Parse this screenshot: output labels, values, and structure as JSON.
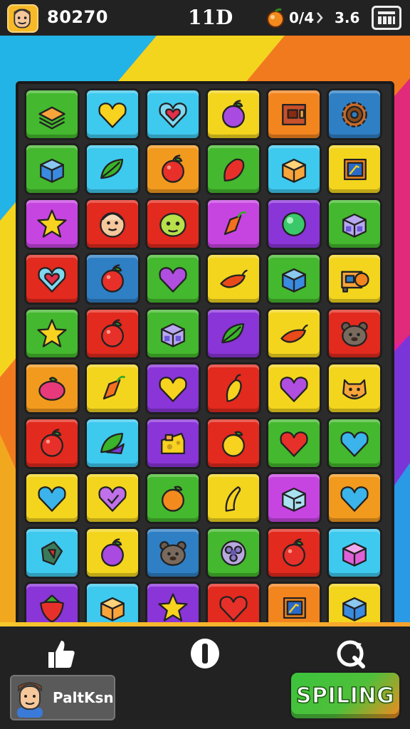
{
  "header": {
    "score": "80270",
    "level": "11D",
    "fruit_ratio": "0/4",
    "moves": "3.6",
    "fruit_icon": "orange-fruit-icon",
    "menu_icon": "grid-menu-icon"
  },
  "board": {
    "rows": [
      [
        {
          "c": "#44b82e",
          "i": "layers"
        },
        {
          "c": "#3ec9ef",
          "i": "heart-yellow"
        },
        {
          "c": "#3ec9ef",
          "i": "heart-outline"
        },
        {
          "c": "#f3d51e",
          "i": "apple-purple"
        },
        {
          "c": "#f2851e",
          "i": "box-brown"
        },
        {
          "c": "#2f7fc4",
          "i": "gear"
        }
      ],
      [
        {
          "c": "#44b82e",
          "i": "cube-blue"
        },
        {
          "c": "#3ec9ef",
          "i": "leaf-green"
        },
        {
          "c": "#f29a1e",
          "i": "apple-red"
        },
        {
          "c": "#44b82e",
          "i": "pepper-red"
        },
        {
          "c": "#3ec9ef",
          "i": "box-orange"
        },
        {
          "c": "#f3d51e",
          "i": "card-blue"
        }
      ],
      [
        {
          "c": "#c645e0",
          "i": "star-yellow"
        },
        {
          "c": "#e22a1e",
          "i": "face-round"
        },
        {
          "c": "#e22a1e",
          "i": "face-green"
        },
        {
          "c": "#c645e0",
          "i": "carrot"
        },
        {
          "c": "#8a35d8",
          "i": "ball-green"
        },
        {
          "c": "#44b82e",
          "i": "cube-lilac"
        }
      ],
      [
        {
          "c": "#e22a1e",
          "i": "heart-outline"
        },
        {
          "c": "#2f7fc4",
          "i": "apple-red"
        },
        {
          "c": "#44b82e",
          "i": "heart-purple"
        },
        {
          "c": "#f3d51e",
          "i": "chili"
        },
        {
          "c": "#44b82e",
          "i": "cube-blue"
        },
        {
          "c": "#f3d51e",
          "i": "machine"
        }
      ],
      [
        {
          "c": "#44b82e",
          "i": "star-yellow"
        },
        {
          "c": "#e22a1e",
          "i": "apple-red"
        },
        {
          "c": "#44b82e",
          "i": "cube-lilac"
        },
        {
          "c": "#8a35d8",
          "i": "leaf-green"
        },
        {
          "c": "#f3d51e",
          "i": "chili"
        },
        {
          "c": "#e22a1e",
          "i": "face-bear"
        }
      ],
      [
        {
          "c": "#f29a1e",
          "i": "plum"
        },
        {
          "c": "#f3d51e",
          "i": "carrot"
        },
        {
          "c": "#8a35d8",
          "i": "heart-yellow"
        },
        {
          "c": "#e22a1e",
          "i": "pepper-yellow"
        },
        {
          "c": "#f3d51e",
          "i": "heart-purple"
        },
        {
          "c": "#f3d51e",
          "i": "face-tiger"
        }
      ],
      [
        {
          "c": "#e22a1e",
          "i": "apple-red"
        },
        {
          "c": "#3ec9ef",
          "i": "leaf-purple"
        },
        {
          "c": "#8a35d8",
          "i": "cheese"
        },
        {
          "c": "#e22a1e",
          "i": "apple-yellow"
        },
        {
          "c": "#44b82e",
          "i": "heart-red"
        },
        {
          "c": "#44b82e",
          "i": "heart-blue"
        }
      ],
      [
        {
          "c": "#f3d51e",
          "i": "heart-blue"
        },
        {
          "c": "#f3d51e",
          "i": "heart-outline-purple"
        },
        {
          "c": "#44b82e",
          "i": "orange"
        },
        {
          "c": "#f3d51e",
          "i": "banana"
        },
        {
          "c": "#c645e0",
          "i": "box-lightblue"
        },
        {
          "c": "#f29a1e",
          "i": "heart-blue"
        }
      ],
      [
        {
          "c": "#3ec9ef",
          "i": "shield"
        },
        {
          "c": "#f3d51e",
          "i": "apple-purple"
        },
        {
          "c": "#2f7fc4",
          "i": "face-bear"
        },
        {
          "c": "#44b82e",
          "i": "flower"
        },
        {
          "c": "#e22a1e",
          "i": "apple-red"
        },
        {
          "c": "#3ec9ef",
          "i": "cube-pink"
        }
      ],
      [
        {
          "c": "#8a35d8",
          "i": "strawberry"
        },
        {
          "c": "#3ec9ef",
          "i": "box-orange"
        },
        {
          "c": "#8a35d8",
          "i": "star-yellow"
        },
        {
          "c": "#e22a1e",
          "i": "heart-red"
        },
        {
          "c": "#f2851e",
          "i": "card-blue"
        },
        {
          "c": "#f3d51e",
          "i": "cube-blue"
        }
      ]
    ]
  },
  "footer": {
    "left_icon": "thumbs-up-icon",
    "center_icon": "pause-icon",
    "right_icon": "refresh-icon",
    "player_name": "PaltKsn",
    "play_label": "SPILING"
  }
}
